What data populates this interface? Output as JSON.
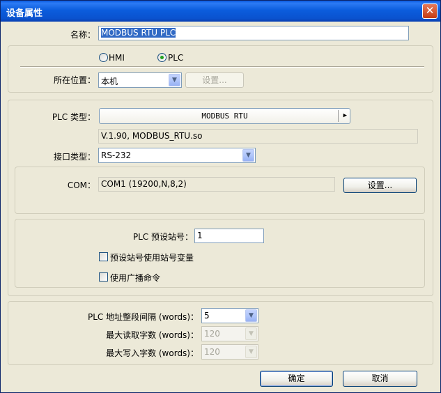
{
  "window": {
    "title": "设备属性",
    "close_glyph": "✕"
  },
  "name": {
    "label": "名称：",
    "value": "MODBUS RTU PLC"
  },
  "location": {
    "radio_hmi": "HMI",
    "radio_plc": "PLC",
    "selected": "PLC",
    "label": "所在位置：",
    "value": "本机",
    "settings_button": "设置..."
  },
  "plc": {
    "type_label": "PLC 类型：",
    "type_value": "MODBUS RTU",
    "version": "V.1.90, MODBUS_RTU.so",
    "interface_label": "接口类型：",
    "interface_value": "RS-232"
  },
  "com": {
    "label": "COM：",
    "value": "COM1 (19200,N,8,2)",
    "settings_button": "设置..."
  },
  "station": {
    "label": "PLC 预设站号：",
    "value": "1",
    "checkbox_var": "预设站号使用站号变量",
    "checkbox_broadcast": "使用广播命令"
  },
  "words": {
    "interval_label": "PLC 地址整段间隔 (words)：",
    "interval_value": "5",
    "max_read_label": "最大读取字数 (words)：",
    "max_read_value": "120",
    "max_write_label": "最大写入字数 (words)：",
    "max_write_value": "120"
  },
  "footer": {
    "ok": "确定",
    "cancel": "取消"
  },
  "icons": {
    "dropdown": "dropdown-arrow-icon",
    "submenu": "triangle-right-icon"
  }
}
